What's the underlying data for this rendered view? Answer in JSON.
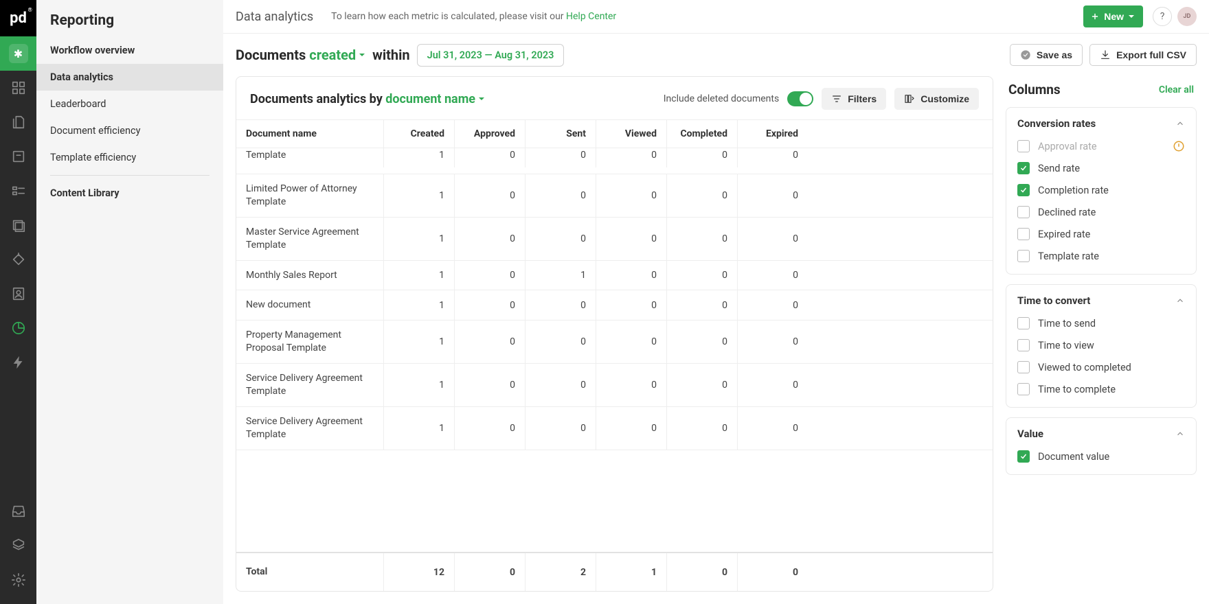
{
  "logo_text": "pd",
  "logo_mark": "®",
  "sidebar": {
    "title": "Reporting",
    "items": [
      {
        "label": "Workflow overview",
        "bold": true
      },
      {
        "label": "Data analytics",
        "active": true
      },
      {
        "label": "Leaderboard"
      },
      {
        "label": "Document efficiency"
      },
      {
        "label": "Template efficiency"
      },
      {
        "divider": true
      },
      {
        "label": "Content Library",
        "bold": true
      }
    ]
  },
  "header": {
    "crumb": "Data analytics",
    "help_pre": "To learn how each metric is calculated, please visit our ",
    "help_link": "Help Center",
    "new_label": "New",
    "avatar": "JD"
  },
  "query": {
    "prefix": "Documents",
    "dropdown": "created",
    "within": "within",
    "date": "Jul 31, 2023 — Aug 31, 2023",
    "save_label": "Save as",
    "export_label": "Export full CSV"
  },
  "table": {
    "title_pre": "Documents analytics by",
    "title_drop": "document name",
    "include_label": "Include deleted documents",
    "filters_label": "Filters",
    "customize_label": "Customize",
    "columns": [
      "Document name",
      "Created",
      "Approved",
      "Sent",
      "Viewed",
      "Completed",
      "Expired"
    ],
    "partial_first": "Limited Power of Attorney Template",
    "partial_vals": [
      "1",
      "0",
      "0",
      "0",
      "0",
      "0"
    ],
    "rows": [
      {
        "name": "Limited Power of Attorney Template",
        "v": [
          "1",
          "0",
          "0",
          "0",
          "0",
          "0"
        ]
      },
      {
        "name": "Master Service Agreement Template",
        "v": [
          "1",
          "0",
          "0",
          "0",
          "0",
          "0"
        ]
      },
      {
        "name": "Monthly Sales Report",
        "v": [
          "1",
          "0",
          "1",
          "0",
          "0",
          "0"
        ]
      },
      {
        "name": "New document",
        "v": [
          "1",
          "0",
          "0",
          "0",
          "0",
          "0"
        ]
      },
      {
        "name": "Property Management Proposal Template",
        "v": [
          "1",
          "0",
          "0",
          "0",
          "0",
          "0"
        ]
      },
      {
        "name": "Service Delivery Agreement Template",
        "v": [
          "1",
          "0",
          "0",
          "0",
          "0",
          "0"
        ]
      },
      {
        "name": "Service Delivery Agreement Template",
        "v": [
          "1",
          "0",
          "0",
          "0",
          "0",
          "0"
        ]
      }
    ],
    "total_label": "Total",
    "totals": [
      "12",
      "0",
      "2",
      "1",
      "0",
      "0"
    ]
  },
  "columns_panel": {
    "title": "Columns",
    "clear": "Clear all",
    "groups": [
      {
        "title": "Conversion rates",
        "items": [
          {
            "label": "Approval rate",
            "checked": false,
            "disabled": true,
            "warn": true
          },
          {
            "label": "Send rate",
            "checked": true
          },
          {
            "label": "Completion rate",
            "checked": true
          },
          {
            "label": "Declined rate",
            "checked": false
          },
          {
            "label": "Expired rate",
            "checked": false
          },
          {
            "label": "Template rate",
            "checked": false
          }
        ]
      },
      {
        "title": "Time to convert",
        "items": [
          {
            "label": "Time to send",
            "checked": false
          },
          {
            "label": "Time to view",
            "checked": false
          },
          {
            "label": "Viewed to completed",
            "checked": false
          },
          {
            "label": "Time to complete",
            "checked": false
          }
        ]
      },
      {
        "title": "Value",
        "items": [
          {
            "label": "Document value",
            "checked": true
          }
        ]
      }
    ]
  }
}
